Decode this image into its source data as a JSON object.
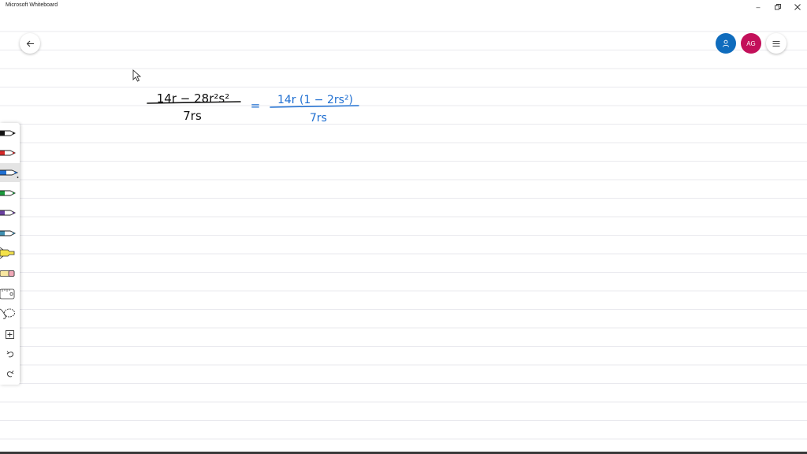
{
  "window": {
    "title": "Microsoft Whiteboard",
    "controls": [
      "minimize",
      "restore",
      "close"
    ]
  },
  "header": {
    "back_icon": "arrow-left-icon",
    "invite_icon": "person-icon",
    "user_initials": "AG",
    "menu_icon": "hamburger-menu-icon"
  },
  "toolbar": {
    "tools": [
      {
        "name": "black-pen",
        "color": "#111111"
      },
      {
        "name": "red-pen",
        "color": "#d62828"
      },
      {
        "name": "blue-pen",
        "color": "#1f6fd1",
        "selected": true
      },
      {
        "name": "green-pen",
        "color": "#1a9a3c"
      },
      {
        "name": "purple-pen",
        "color": "#6a3fa0"
      },
      {
        "name": "teal-pen",
        "color": "#3f8fb0"
      },
      {
        "name": "highlighter",
        "color": "#f4e24a"
      },
      {
        "name": "eraser",
        "color": "#f0a8b8"
      },
      {
        "name": "ruler"
      },
      {
        "name": "lasso-select"
      },
      {
        "name": "add-content"
      },
      {
        "name": "undo"
      },
      {
        "name": "redo"
      }
    ]
  },
  "ink": {
    "left_expression": {
      "numerator": "14r − 28r²s²",
      "denominator": "7rs",
      "color": "#111111"
    },
    "equals": {
      "text": "=",
      "color": "#1f6fd1"
    },
    "right_expression": {
      "numerator": "14r (1 − 2rs²)",
      "denominator": "7rs",
      "color": "#1f6fd1"
    }
  },
  "colors": {
    "accent_blue": "#0f6cbd",
    "avatar_magenta": "#c3105a",
    "grid_line": "#e9e9ee"
  }
}
